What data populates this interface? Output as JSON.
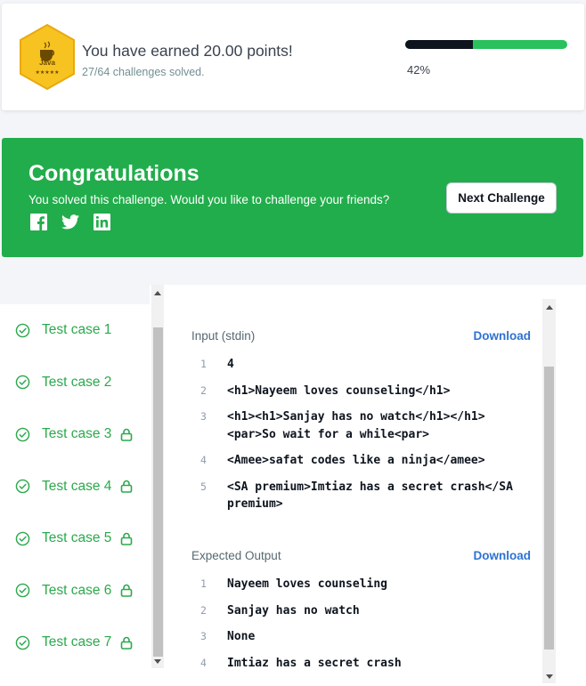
{
  "points": {
    "badge_label": "Java",
    "badge_stars": "★★★★★",
    "title": "You have earned 20.00 points!",
    "challenges": "27/64 challenges solved.",
    "progress_fraction": 0.42,
    "progress_label": "42%"
  },
  "banner": {
    "title": "Congratulations",
    "subtitle": "You solved this challenge. Would you like to challenge your friends?",
    "next_button": "Next Challenge",
    "social_icons": [
      "facebook-icon",
      "twitter-icon",
      "linkedin-icon"
    ]
  },
  "test_cases": [
    {
      "label": "Test case 1",
      "locked": false
    },
    {
      "label": "Test case 2",
      "locked": false
    },
    {
      "label": "Test case 3",
      "locked": true
    },
    {
      "label": "Test case 4",
      "locked": true
    },
    {
      "label": "Test case 5",
      "locked": true
    },
    {
      "label": "Test case 6",
      "locked": true
    },
    {
      "label": "Test case 7",
      "locked": true
    }
  ],
  "input": {
    "title": "Input (stdin)",
    "download": "Download",
    "lines": [
      {
        "n": "1",
        "text": "4"
      },
      {
        "n": "2",
        "text": "<h1>Nayeem loves counseling</h1>"
      },
      {
        "n": "3",
        "text": "<h1><h1>Sanjay has no watch</h1></h1><par>So wait for a while<par>"
      },
      {
        "n": "4",
        "text": "<Amee>safat codes like a ninja</amee>"
      },
      {
        "n": "5",
        "text": "<SA premium>Imtiaz has a secret crash</SA premium>"
      }
    ]
  },
  "output": {
    "title": "Expected Output",
    "download": "Download",
    "lines": [
      {
        "n": "1",
        "text": "Nayeem loves counseling"
      },
      {
        "n": "2",
        "text": "Sanjay has no watch"
      },
      {
        "n": "3",
        "text": "None"
      },
      {
        "n": "4",
        "text": "Imtiaz has a secret crash"
      }
    ]
  },
  "colors": {
    "success_green": "#21ad4b",
    "text_green": "#2ba94c",
    "link_blue": "#2e72d2",
    "badge_gold": "#f5c518"
  }
}
